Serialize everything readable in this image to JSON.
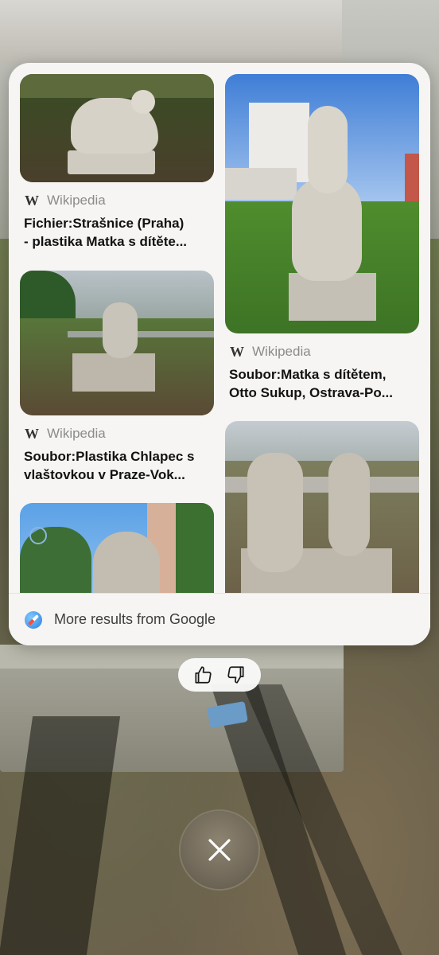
{
  "results": [
    {
      "source": "Wikipedia",
      "source_icon": "wikipedia-w-icon",
      "title_lines": [
        "Fichier:Strašnice (Praha)",
        "- plastika Matka s dítěte..."
      ]
    },
    {
      "source": "Wikipedia",
      "source_icon": "wikipedia-w-icon",
      "title_lines": [
        "Soubor:Matka s dítětem,",
        "Otto Sukup, Ostrava-Po..."
      ]
    },
    {
      "source": "Wikipedia",
      "source_icon": "wikipedia-w-icon",
      "title_lines": [
        "Soubor:Plastika Chlapec s",
        "vlaštovkou v Praze-Vok..."
      ]
    }
  ],
  "wikipedia_logo": "W",
  "footer": {
    "label": "More results from Google",
    "icon": "safari-compass-icon"
  },
  "feedback": {
    "like_icon": "thumbs-up-icon",
    "dislike_icon": "thumbs-down-icon"
  },
  "close": {
    "icon": "close-x-icon"
  },
  "colors": {
    "card_bg": "#f6f5f3",
    "source_text": "#8b8b8b",
    "title_text": "#121212"
  }
}
